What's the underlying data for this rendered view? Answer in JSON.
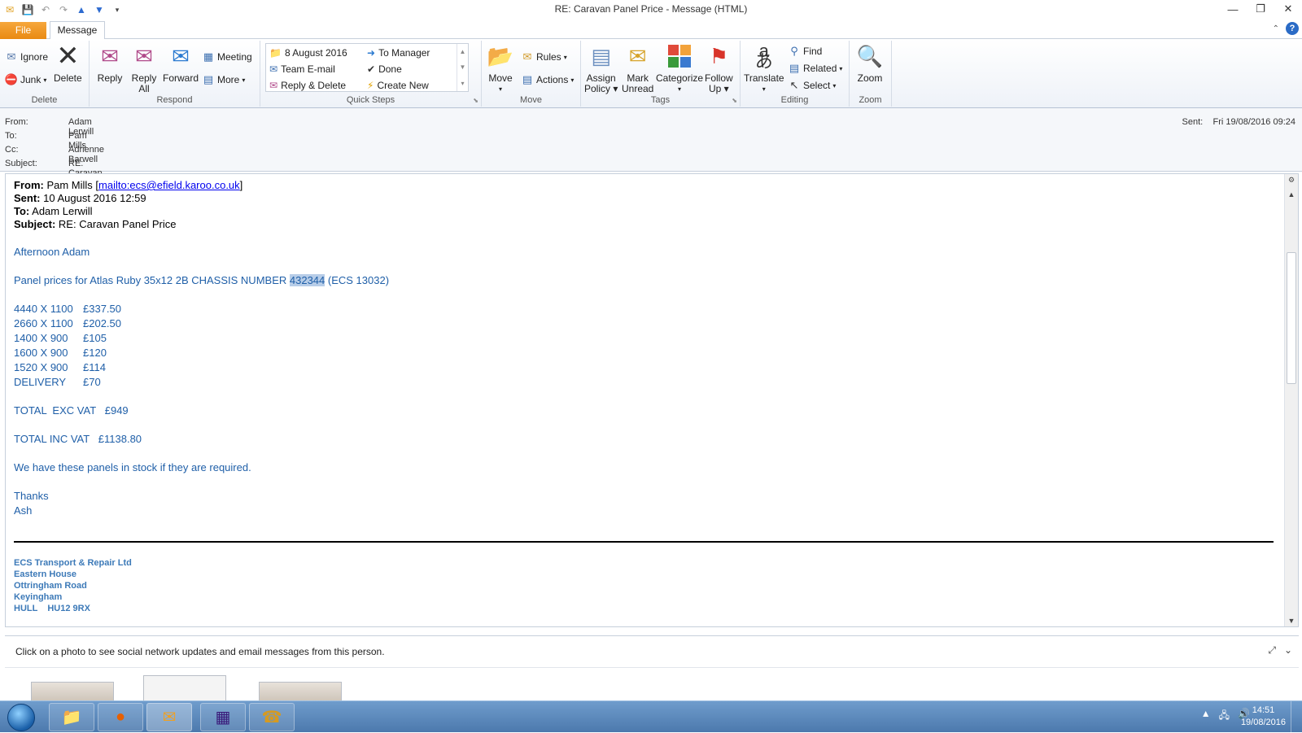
{
  "window": {
    "title": "RE: Caravan Panel Price  -  Message (HTML)"
  },
  "tabs": {
    "file": "File",
    "message": "Message"
  },
  "ribbon": {
    "delete_group": {
      "label": "Delete",
      "ignore": "Ignore",
      "junk": "Junk",
      "delete": "Delete"
    },
    "respond_group": {
      "label": "Respond",
      "reply": "Reply",
      "reply_all_1": "Reply",
      "reply_all_2": "All",
      "forward": "Forward",
      "meeting": "Meeting",
      "more": "More"
    },
    "quicksteps_group": {
      "label": "Quick Steps",
      "items": [
        "8 August 2016",
        "Team E-mail",
        "Reply & Delete",
        "To Manager",
        "Done",
        "Create New"
      ]
    },
    "move_group": {
      "label": "Move",
      "move": "Move",
      "rules": "Rules",
      "actions": "Actions"
    },
    "tags_group": {
      "label": "Tags",
      "assign_1": "Assign",
      "assign_2": "Policy",
      "mark_1": "Mark",
      "mark_2": "Unread",
      "categorize": "Categorize",
      "follow_1": "Follow",
      "follow_2": "Up"
    },
    "editing_group": {
      "label": "Editing",
      "translate": "Translate",
      "find": "Find",
      "related": "Related",
      "select": "Select"
    },
    "zoom_group": {
      "label": "Zoom",
      "zoom": "Zoom"
    }
  },
  "header": {
    "from_label": "From:",
    "from": "Adam Lerwill",
    "to_label": "To:",
    "to": "Pam Mills",
    "cc_label": "Cc:",
    "cc": "Adrienne Barwell",
    "subject_label": "Subject:",
    "subject": "RE: Caravan Panel Price",
    "sent_label": "Sent:",
    "sent": "Fri 19/08/2016 09:24"
  },
  "quoted": {
    "from_label": "From:",
    "from_name": "Pam Mills",
    "from_link": "mailto:ecs@efield.karoo.co.uk",
    "sent_label": "Sent:",
    "sent": "10 August 2016 12:59",
    "to_label": "To:",
    "to": "Adam Lerwill",
    "subject_label": "Subject:",
    "subject": "RE: Caravan Panel Price"
  },
  "message": {
    "greeting": "Afternoon Adam",
    "intro_before": "Panel prices for Atlas Ruby 35x12 2B CHASSIS NUMBER ",
    "intro_highlight": "432344",
    "intro_after": " (ECS 13032)",
    "prices": [
      {
        "item": "4440 X 1100",
        "price": "£337.50"
      },
      {
        "item": "2660 X 1100",
        "price": "£202.50"
      },
      {
        "item": "1400 X 900",
        "price": "£105"
      },
      {
        "item": "1600 X 900",
        "price": "£120"
      },
      {
        "item": "1520 X 900",
        "price": "£114"
      },
      {
        "item": "DELIVERY",
        "price": "£70"
      }
    ],
    "total_exc": "TOTAL  EXC VAT   £949",
    "total_inc": "TOTAL INC VAT   £1138.80",
    "stock_note": "We have these panels in stock if they are required.",
    "thanks": "Thanks",
    "sender": "Ash",
    "signature": [
      "ECS Transport & Repair Ltd",
      "Eastern House",
      "Ottringham Road",
      "Keyingham",
      "HULL    HU12 9RX"
    ]
  },
  "people_pane": {
    "text": "Click on a photo to see social network updates and email messages from this person."
  },
  "taskbar": {
    "time": "14:51",
    "date": "19/08/2016"
  }
}
